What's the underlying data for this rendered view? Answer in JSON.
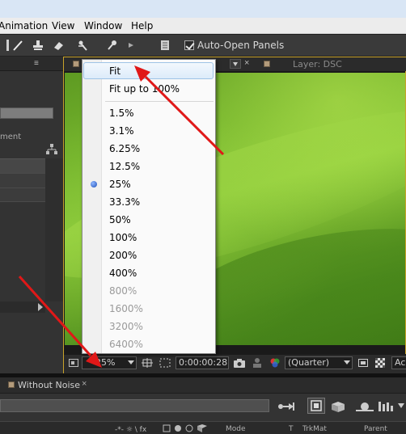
{
  "menubar": {
    "items": [
      {
        "label": "Animation"
      },
      {
        "label": "View"
      },
      {
        "label": "Window"
      },
      {
        "label": "Help"
      }
    ]
  },
  "toolbar": {
    "auto_open_panels_label": "Auto-Open Panels",
    "auto_open_panels_checked": true
  },
  "left_panel": {
    "column_title": "ment"
  },
  "comp_panel": {
    "tab_layer_label": "Layer: DSC"
  },
  "zoom_menu": {
    "options": [
      {
        "label": "Fit",
        "highlighted": true,
        "enabled": true
      },
      {
        "label": "Fit up to 100%",
        "enabled": true
      },
      {
        "label": "1.5%",
        "enabled": true
      },
      {
        "label": "3.1%",
        "enabled": true
      },
      {
        "label": "6.25%",
        "enabled": true
      },
      {
        "label": "12.5%",
        "enabled": true
      },
      {
        "label": "25%",
        "enabled": true,
        "selected": true
      },
      {
        "label": "33.3%",
        "enabled": true
      },
      {
        "label": "50%",
        "enabled": true
      },
      {
        "label": "100%",
        "enabled": true
      },
      {
        "label": "200%",
        "enabled": true
      },
      {
        "label": "400%",
        "enabled": true
      },
      {
        "label": "800%",
        "enabled": false
      },
      {
        "label": "1600%",
        "enabled": false
      },
      {
        "label": "3200%",
        "enabled": false
      },
      {
        "label": "6400%",
        "enabled": false
      }
    ]
  },
  "comp_footer": {
    "zoom_value": "25%",
    "timecode": "0:00:00:28",
    "resolution": "(Quarter)",
    "partial_label": "Ac"
  },
  "timeline": {
    "tab_label": "Without Noise",
    "headers": {
      "mode": "Mode",
      "t": "T",
      "trkmat": "TrkMat",
      "parent": "Parent"
    }
  },
  "colors": {
    "highlight_border": "#c8a22a",
    "annotation_arrow": "#e01818",
    "panel_bg": "#333333"
  }
}
